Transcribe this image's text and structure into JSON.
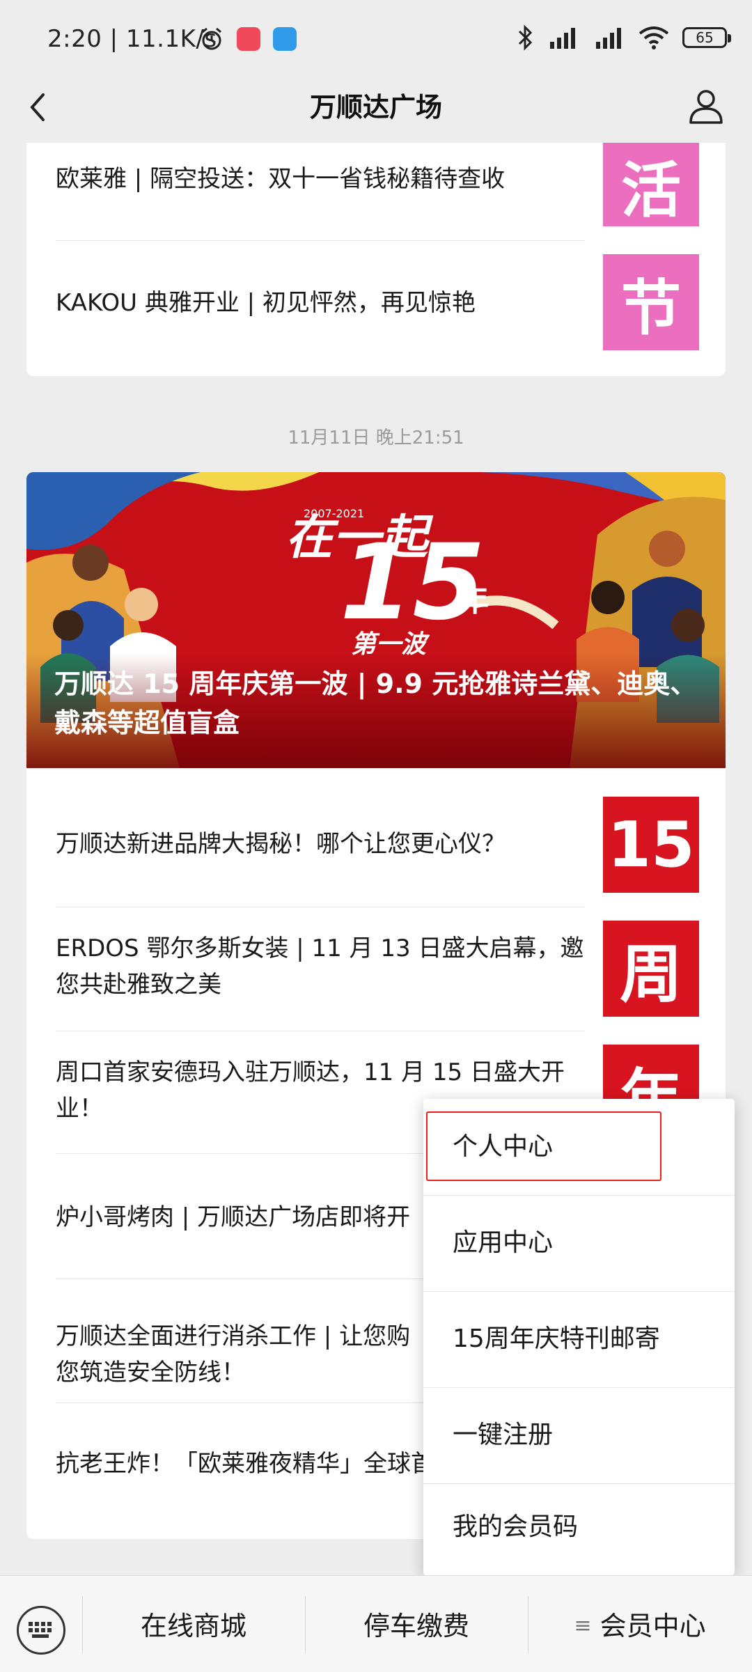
{
  "status": {
    "time_speed": "2:20 | 11.1K/s",
    "battery": "65"
  },
  "nav": {
    "title": "万顺达广场"
  },
  "card1": {
    "items": [
      {
        "title": "欧莱雅 | 隔空投送：双十一省钱秘籍待查收",
        "thumb": "活"
      },
      {
        "title": "KAKOU 典雅开业 | 初见怦然，再见惊艳",
        "thumb": "节"
      }
    ]
  },
  "timestamp": "11月11日 晚上21:51",
  "card2": {
    "banner": {
      "year_range": "2007-2021",
      "slogan": "在一起",
      "number": "15",
      "year_word": "年",
      "sub": "第一波",
      "caption": "万顺达 15 周年庆第一波 | 9.9 元抢雅诗兰黛、迪奥、戴森等超值盲盒"
    },
    "items": [
      {
        "title": "万顺达新进品牌大揭秘！哪个让您更心仪？",
        "thumb": "15"
      },
      {
        "title": "ERDOS 鄂尔多斯女装 | 11 月 13 日盛大启幕，邀您共赴雅致之美",
        "thumb": "周"
      },
      {
        "title": "周口首家安德玛入驻万顺达，11 月 15 日盛大开业！",
        "thumb": "年"
      },
      {
        "title": "炉小哥烤肉 | 万顺达广场店即将开"
      },
      {
        "title": "万顺达全面进行消杀工作 | 让您购\n您筑造安全防线！"
      },
      {
        "title": "抗老王炸！「欧莱雅夜精华」全球首"
      }
    ]
  },
  "menu": {
    "items": [
      "个人中心",
      "应用中心",
      "15周年庆特刊邮寄",
      "一键注册",
      "我的会员码"
    ]
  },
  "bottom": {
    "items": [
      "在线商城",
      "停车缴费",
      "会员中心"
    ],
    "menu_glyph": "≡"
  }
}
